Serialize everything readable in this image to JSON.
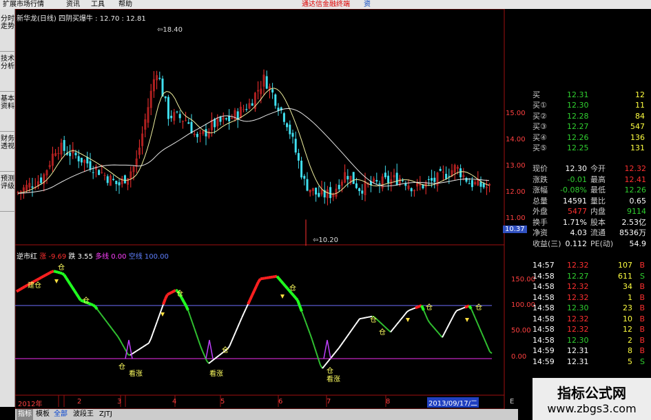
{
  "menu": {
    "items": [
      "扩展市场行情",
      "资讯",
      "工具",
      "帮助"
    ],
    "right_text": "通达信金融终端",
    "edge": "资"
  },
  "left_tabs": [
    "分时走势",
    "技术分析",
    "基本资料",
    "财务透视",
    "预测评级"
  ],
  "main_chart": {
    "header": "新华龙(日线)  四阴买爆牛 : 12.70 : 12.81",
    "price_high": "18.40",
    "price_low": "10.20",
    "axis_labels": [
      "15.00",
      "14.00",
      "13.00",
      "12.00",
      "11.00"
    ],
    "current_price": "10.37"
  },
  "indicator": {
    "name": "逆市红",
    "rise_label": "涨",
    "rise_val": "-9.69",
    "fall_label": "跌",
    "fall_val": "3.55",
    "long_label": "多线",
    "long_val": "0.00",
    "short_label": "空线",
    "short_val": "100.00",
    "axis_labels": [
      "150.00",
      "100.00",
      "50.00",
      "0.00"
    ],
    "labels": [
      "仓",
      "建仓",
      "仓",
      "仓",
      "看涨",
      "仓",
      "看涨",
      "仓",
      "看涨",
      "仓",
      "仓",
      "仓",
      "仓",
      "仓",
      "仓"
    ]
  },
  "time_axis": {
    "labels": [
      "2012年",
      "2",
      "3",
      "4",
      "5",
      "6",
      "7",
      "8"
    ],
    "date_box": "2013/09/17/二",
    "edge": "E"
  },
  "quote": {
    "buy": [
      {
        "label": "买①",
        "price": "12.30",
        "vol": "11"
      },
      {
        "label": "买②",
        "price": "12.28",
        "vol": "84"
      },
      {
        "label": "买③",
        "price": "12.27",
        "vol": "547"
      },
      {
        "label": "买④",
        "price": "12.26",
        "vol": "136"
      },
      {
        "label": "买⑤",
        "price": "12.25",
        "vol": "131"
      }
    ],
    "top_label": "买",
    "top_price": "12.31",
    "top_vol": "12",
    "stats": [
      {
        "l1": "现价",
        "v1": "12.30",
        "l2": "今开",
        "v2": "12.32"
      },
      {
        "l1": "涨跌",
        "v1": "-0.01",
        "l2": "最高",
        "v2": "12.41"
      },
      {
        "l1": "涨幅",
        "v1": "-0.08%",
        "l2": "最低",
        "v2": "12.26"
      },
      {
        "l1": "总量",
        "v1": "14591",
        "l2": "量比",
        "v2": "0.65"
      },
      {
        "l1": "外盘",
        "v1": "5477",
        "l2": "内盘",
        "v2": "9114"
      },
      {
        "l1": "换手",
        "v1": "1.71%",
        "l2": "股本",
        "v2": "2.53亿"
      },
      {
        "l1": "净资",
        "v1": "4.03",
        "l2": "流通",
        "v2": "8536万"
      },
      {
        "l1": "收益(三)",
        "v1": "0.112",
        "l2": "PE(动)",
        "v2": "54.9"
      }
    ],
    "ticks": [
      {
        "t": "14:57",
        "p": "12.32",
        "v": "107",
        "d": "B"
      },
      {
        "t": "14:58",
        "p": "12.27",
        "v": "611",
        "d": "S"
      },
      {
        "t": "14:58",
        "p": "12.32",
        "v": "34",
        "d": "B"
      },
      {
        "t": "14:58",
        "p": "12.32",
        "v": "1",
        "d": "B"
      },
      {
        "t": "14:58",
        "p": "12.30",
        "v": "23",
        "d": "B"
      },
      {
        "t": "14:58",
        "p": "12.32",
        "v": "10",
        "d": "B"
      },
      {
        "t": "14:58",
        "p": "12.32",
        "v": "12",
        "d": "B"
      },
      {
        "t": "14:58",
        "p": "12.30",
        "v": "2",
        "d": "B"
      },
      {
        "t": "14:59",
        "p": "12.31",
        "v": "8",
        "d": "B"
      },
      {
        "t": "14:59",
        "p": "12.31",
        "v": "5",
        "d": "S"
      }
    ]
  },
  "bottom_tabs": [
    "指标",
    "模板",
    "全部",
    "波段王",
    "ZJTJ"
  ],
  "watermark": {
    "title": "指标公式网",
    "url": "www.zbgs3.com"
  },
  "colors": {
    "up": "#ff3030",
    "down": "#00e0e0",
    "green": "#33cc33",
    "yellow": "#ffff00"
  }
}
